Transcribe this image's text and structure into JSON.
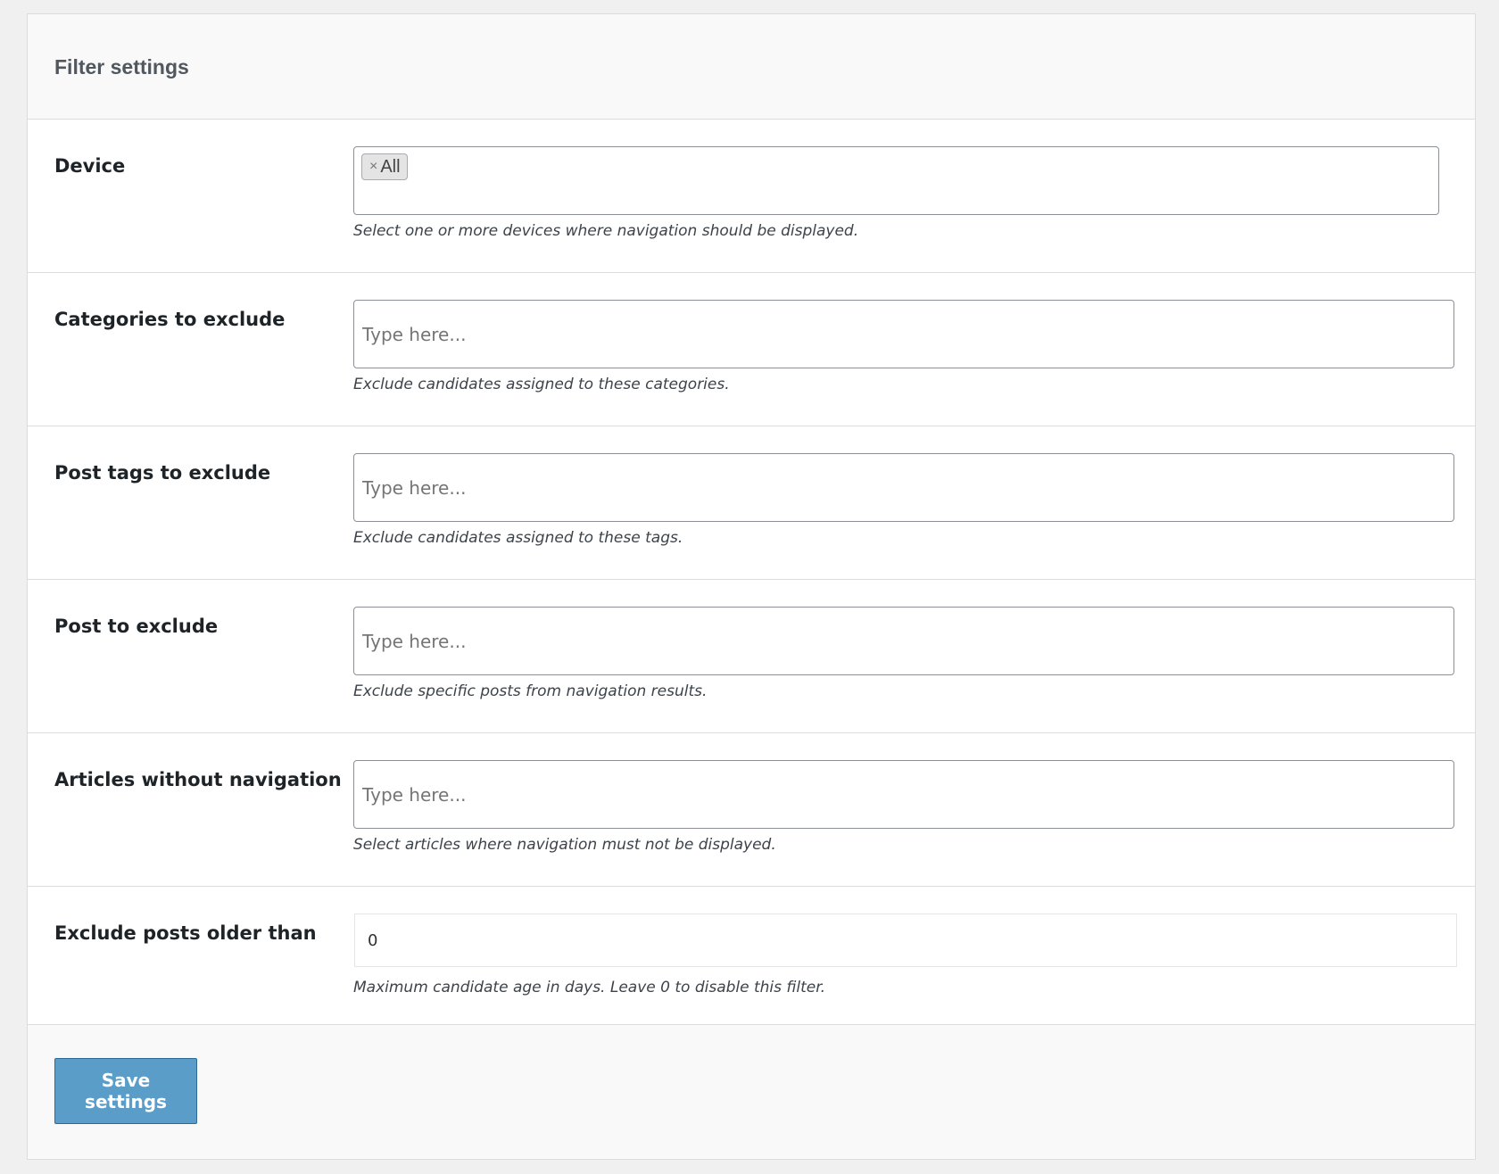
{
  "panel": {
    "title": "Filter settings"
  },
  "fields": {
    "device": {
      "label": "Device",
      "selected_tags": [
        "All"
      ],
      "remove_glyph": "×",
      "description": "Select one or more devices where navigation should be displayed."
    },
    "categories": {
      "label": "Categories to exclude",
      "placeholder": "Type here...",
      "description": "Exclude candidates assigned to these categories."
    },
    "post_tags": {
      "label": "Post tags to exclude",
      "placeholder": "Type here...",
      "description": "Exclude candidates assigned to these tags."
    },
    "posts": {
      "label": "Post to exclude",
      "placeholder": "Type here...",
      "description": "Exclude specific posts from navigation results."
    },
    "articles_without_nav": {
      "label": "Articles without navigation",
      "placeholder": "Type here...",
      "description": "Select articles where navigation must not be displayed."
    },
    "older_than": {
      "label": "Exclude posts older than",
      "value": "0",
      "description": "Maximum candidate age in days. Leave 0 to disable this filter."
    }
  },
  "footer": {
    "save_label": "Save settings"
  },
  "colors": {
    "background": "#f0f0f1",
    "panel_header": "#f9f9f9",
    "button": "#5b9dc9",
    "border": "#dcdcde"
  }
}
